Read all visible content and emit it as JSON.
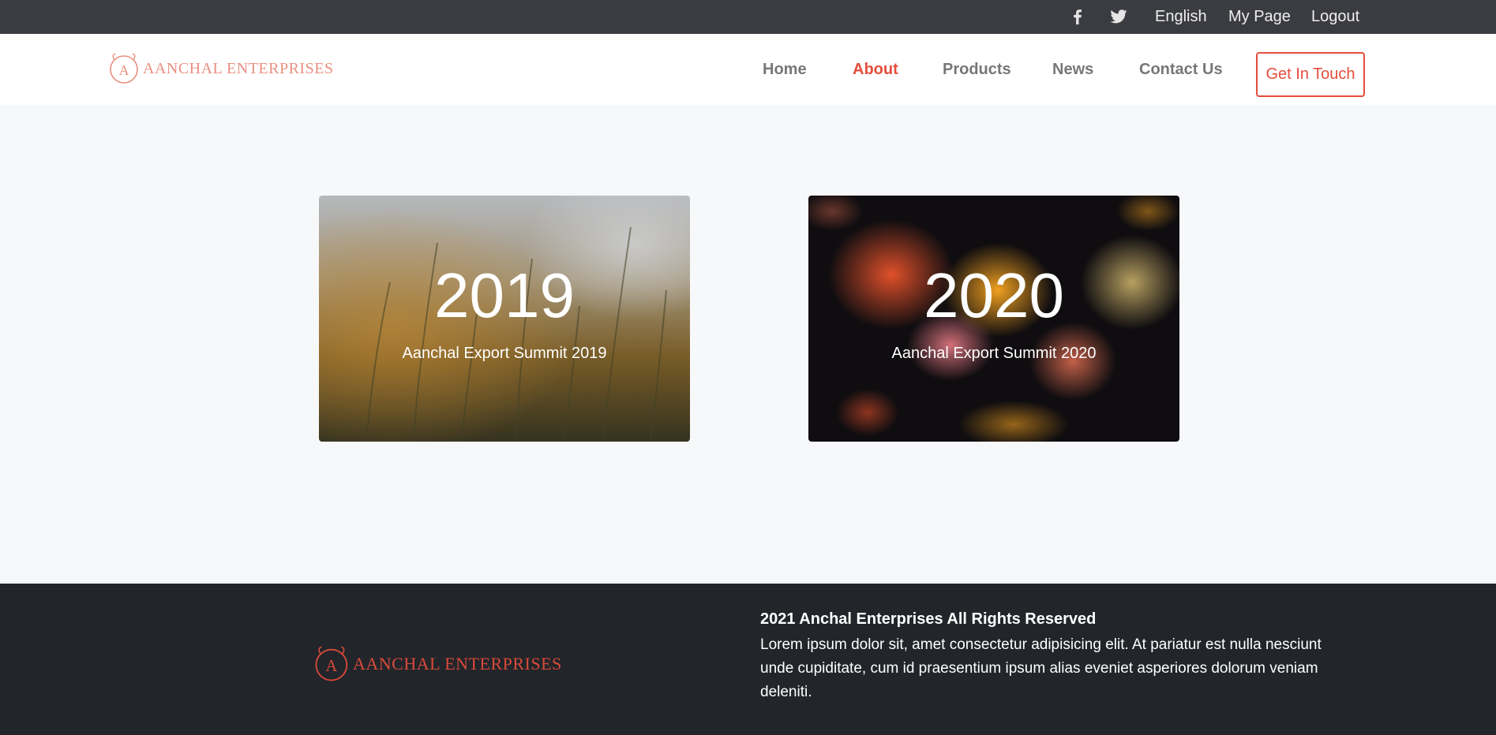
{
  "topbar": {
    "icons": [
      "facebook-icon",
      "twitter-icon"
    ],
    "language": "English",
    "my_page": "My Page",
    "logout": "Logout"
  },
  "navbar": {
    "brand_letter": "A",
    "brand": "AANCHAL ENTERPRISES",
    "items": [
      {
        "label": "Home",
        "active": false
      },
      {
        "label": "About",
        "active": true
      },
      {
        "label": "Products",
        "active": false
      },
      {
        "label": "News",
        "active": false
      },
      {
        "label": "Contact Us",
        "active": false
      }
    ],
    "cta": "Get In Touch"
  },
  "cards": [
    {
      "year": "2019",
      "subtitle": "Aanchal Export Summit 2019"
    },
    {
      "year": "2020",
      "subtitle": "Aanchal Export Summit 2020"
    }
  ],
  "footer": {
    "brand_letter": "A",
    "brand": "AANCHAL ENTERPRISES",
    "title": "2021 Anchal Enterprises All Rights Reserved",
    "text": "Lorem ipsum dolor sit, amet consectetur adipisicing elit. At pariatur est nulla nesciunt unde cupiditate, cum id praesentium ipsum alias eveniet asperiores dolorum veniam deleniti."
  },
  "colors": {
    "accent": "#e54d3c",
    "topbar_bg": "#3b3c41",
    "footer_bg": "#22252a",
    "page_bg": "#f7f8fa"
  }
}
